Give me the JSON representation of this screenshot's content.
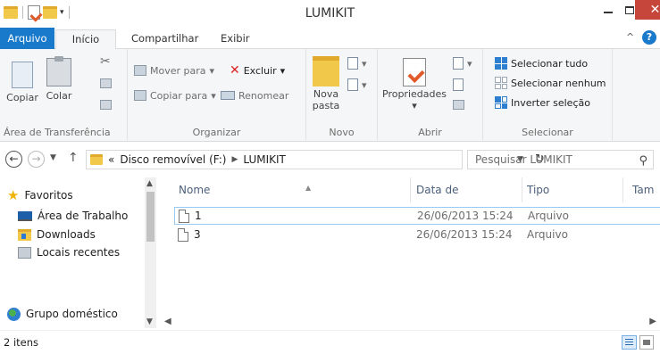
{
  "window": {
    "title": "LUMIKIT"
  },
  "ribbon_tabs": {
    "file": "Arquivo",
    "home": "Início",
    "share": "Compartilhar",
    "view": "Exibir"
  },
  "clipboard": {
    "copy": "Copiar",
    "paste": "Colar",
    "label": "Área de Transferência"
  },
  "organize": {
    "move_to": "Mover para",
    "copy_to": "Copiar para",
    "delete": "Excluir",
    "rename": "Renomear",
    "label": "Organizar"
  },
  "new": {
    "new_folder_line1": "Nova",
    "new_folder_line2": "pasta",
    "label": "Novo"
  },
  "open": {
    "properties": "Propriedades",
    "label": "Abrir"
  },
  "select": {
    "select_all": "Selecionar tudo",
    "select_none": "Selecionar nenhum",
    "invert": "Inverter seleção",
    "label": "Selecionar"
  },
  "address": {
    "overflow": "«",
    "drive": "Disco removível (F:)",
    "folder": "LUMIKIT"
  },
  "search": {
    "placeholder": "Pesquisar LUMIKIT"
  },
  "navpane": {
    "favorites": "Favoritos",
    "desktop": "Área de Trabalho",
    "downloads": "Downloads",
    "recent": "Locais recentes",
    "homegroup": "Grupo doméstico"
  },
  "columns": {
    "name": "Nome",
    "date": "Data de modificaç...",
    "type": "Tipo",
    "size": "Tam"
  },
  "files": [
    {
      "name": "1",
      "date": "26/06/2013 15:24",
      "type": "Arquivo"
    },
    {
      "name": "3",
      "date": "26/06/2013 15:24",
      "type": "Arquivo"
    }
  ],
  "status": {
    "count": "2 itens"
  },
  "colors": {
    "accent": "#1979ca",
    "close": "#c7463b",
    "selection_border": "#99c8f0"
  }
}
